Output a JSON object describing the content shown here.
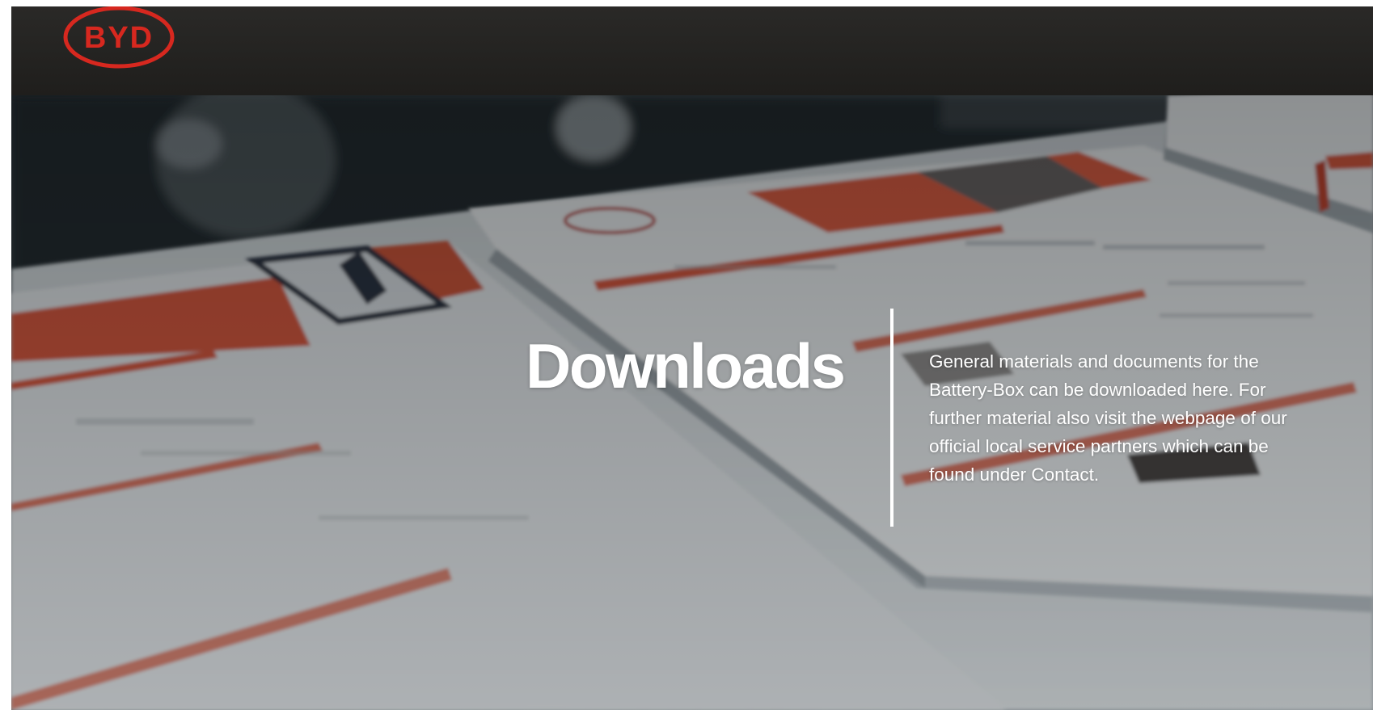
{
  "header": {
    "logo_text": "BYD",
    "logo_color": "#d7281f",
    "background": "#1f1e1c"
  },
  "hero": {
    "title": "Downloads",
    "description": "General materials and documents for the Battery-Box can be downloaded here. For further material also visit the webpage of our official local service partners which can be found under Contact.",
    "text_color": "#ffffff",
    "accent_color": "#e0583a"
  }
}
